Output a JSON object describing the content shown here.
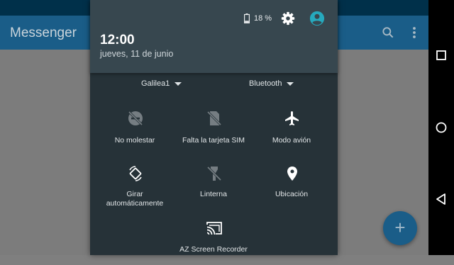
{
  "app": {
    "title": "Messenger",
    "fab_label": "+",
    "colors": {
      "appbar": "#1a5d88",
      "statusbar": "#00304a"
    }
  },
  "shade": {
    "battery": "18 %",
    "time": "12:00",
    "date": "jueves, 11 de junio",
    "wifi_label": "Galilea1",
    "bluetooth_label": "Bluetooth",
    "accent_color": "#26a9bd",
    "tiles": [
      {
        "label": "No molestar",
        "icon": "do-not-disturb-off-icon"
      },
      {
        "label": "Falta la tarjeta SIM",
        "icon": "sim-missing-icon"
      },
      {
        "label": "Modo avión",
        "icon": "airplane-icon"
      },
      {
        "label": "Girar\nautomáticamente",
        "icon": "auto-rotate-icon"
      },
      {
        "label": "Linterna",
        "icon": "flashlight-off-icon"
      },
      {
        "label": "Ubicación",
        "icon": "location-icon"
      },
      {
        "label": "AZ Screen Recorder",
        "icon": "cast-icon"
      }
    ]
  },
  "navbar": {
    "buttons": [
      "recents-icon",
      "home-icon",
      "back-icon"
    ]
  }
}
